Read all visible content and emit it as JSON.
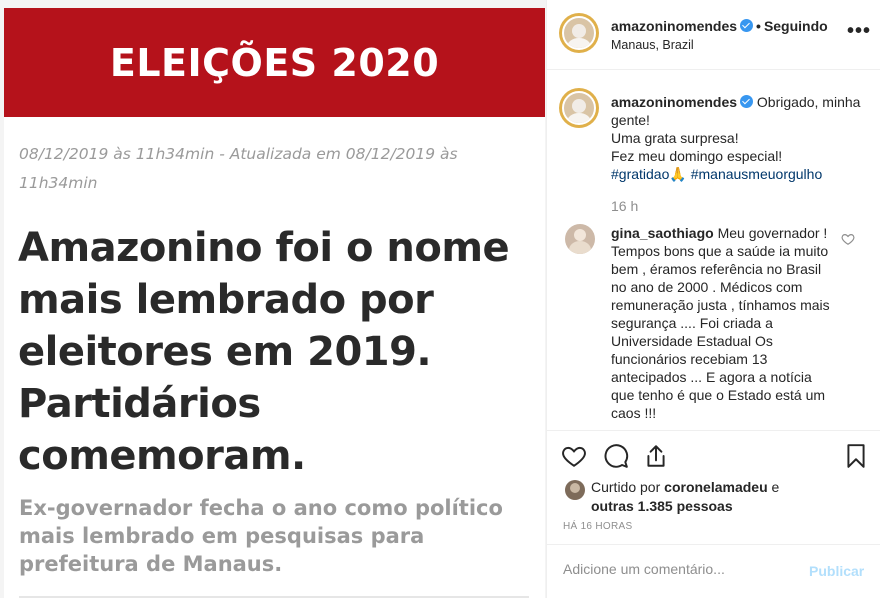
{
  "post_image": {
    "banner": "ELEIÇÕES 2020",
    "dateline": "08/12/2019 às 11h34min - Atualizada em 08/12/2019 às 11h34min",
    "headline": "Amazonino foi o nome mais lembrado por eleitores em 2019. Partidários comemoram.",
    "subhead": "Ex-governador fecha o ano como político mais lembrado em pesquisas para prefeitura de Manaus.",
    "colors": {
      "banner": "#b5121b"
    }
  },
  "header": {
    "username": "amazoninomendes",
    "separator": "•",
    "following": "Seguindo",
    "location": "Manaus, Brazil",
    "more_icon": "•••"
  },
  "caption": {
    "username": "amazoninomendes",
    "line1": "Obrigado, minha gente!",
    "line2": "Uma grata surpresa!",
    "line3": "Fez meu domingo especial!",
    "hashtag1": "#gratidao🙏",
    "hashtag2": "#manausmeuorgulho",
    "time": "16 h"
  },
  "comment": {
    "username": "gina_saothiago",
    "text": "Meu governador ! Tempos bons que a saúde ia muito bem , éramos referência no Brasil no ano de 2000 . Médicos com remuneração justa , tínhamos mais segurança .... Foi criada a Universidade Estadual Os funcionários recebiam 13 antecipados ... E agora a notícia que tenho é que o Estado está um caos !!!"
  },
  "likes": {
    "prefix": "Curtido por",
    "liker": "coronelamadeu",
    "and": "e",
    "others": "outras 1.385 pessoas"
  },
  "timestamp": "HÁ 16 HORAS",
  "comment_box": {
    "placeholder": "Adicione um comentário...",
    "post_label": "Publicar"
  },
  "icons": [
    "more-icon",
    "verified-icon",
    "heart-icon",
    "comment-icon",
    "share-icon",
    "bookmark-icon"
  ],
  "colors": {
    "verified": "#3897f0",
    "hashtag": "#00376b",
    "muted": "#8e8e8e",
    "post_button": "#b2dffc"
  }
}
